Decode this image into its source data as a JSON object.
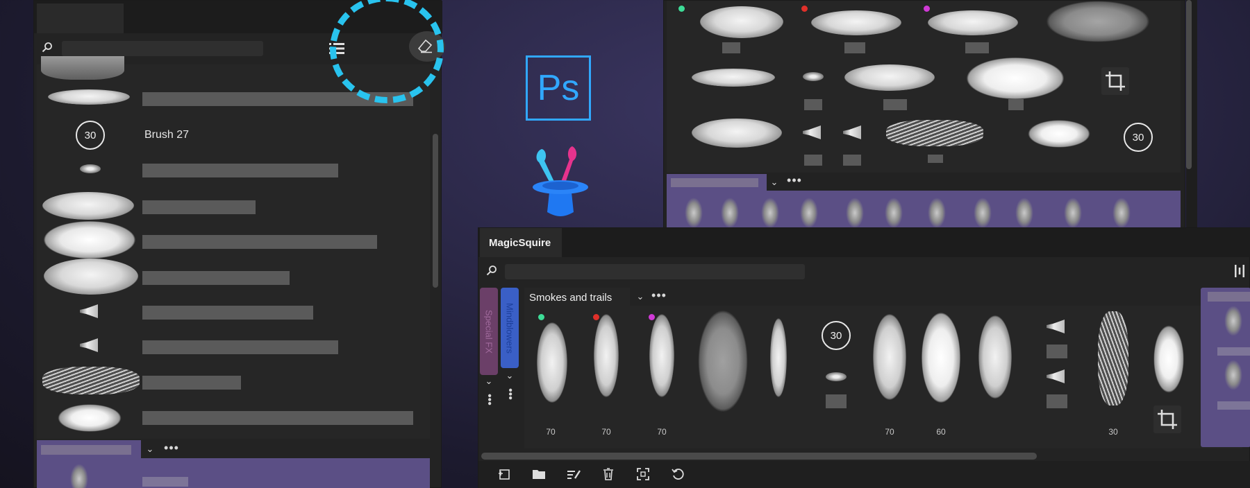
{
  "left_panel": {
    "search_placeholder": "",
    "items": [
      {
        "type": "brush-preset"
      },
      {
        "type": "brush-preset"
      },
      {
        "type": "numbered",
        "number": "30",
        "label": "Brush 27"
      },
      {
        "type": "brush-preset"
      },
      {
        "type": "brush-preset"
      },
      {
        "type": "brush-preset"
      },
      {
        "type": "brush-preset"
      },
      {
        "type": "brush-preset"
      },
      {
        "type": "brush-preset"
      },
      {
        "type": "brush-preset"
      },
      {
        "type": "brush-preset"
      }
    ]
  },
  "logos": {
    "ps_text": "Ps"
  },
  "top_right_panel": {
    "number_badge": "30"
  },
  "magicsquire_panel": {
    "tab_label": "MagicSquire",
    "search_placeholder": "",
    "side_tabs": [
      {
        "label": "Special FX",
        "color": "#6b3f68"
      },
      {
        "label": "Mindblowers",
        "color": "#3a5fc6"
      }
    ],
    "set_title": "Smokes and trails",
    "number_badge": "30",
    "size_labels": [
      "70",
      "70",
      "70",
      "70",
      "60",
      "30"
    ],
    "dot_colors": [
      "#3ddc97",
      "#e0302a",
      "#d03ad6"
    ]
  },
  "colors": {
    "highlight_ring": "#29c3ee",
    "ps_blue": "#31a8ff",
    "purple_group": "#5b4f85"
  }
}
